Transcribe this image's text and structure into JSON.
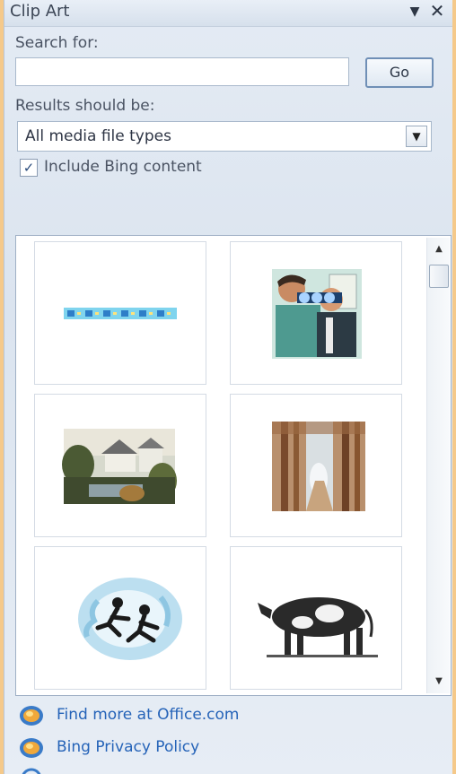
{
  "pane": {
    "title": "Clip Art",
    "menu_glyph": "▼",
    "close_glyph": "✕"
  },
  "search": {
    "label": "Search for:",
    "value": "",
    "placeholder": "",
    "go_label": "Go"
  },
  "results_filter": {
    "label": "Results should be:",
    "selected": "All media file types",
    "arrow_glyph": "▼"
  },
  "include_bing": {
    "label": "Include Bing content",
    "checked": true,
    "check_glyph": "✓"
  },
  "scrollbar": {
    "up_glyph": "▲",
    "down_glyph": "▼"
  },
  "links": [
    {
      "label": "Find more at Office.com",
      "icon": "office-globe-icon"
    },
    {
      "label": "Bing Privacy Policy",
      "icon": "office-globe-icon"
    }
  ]
}
